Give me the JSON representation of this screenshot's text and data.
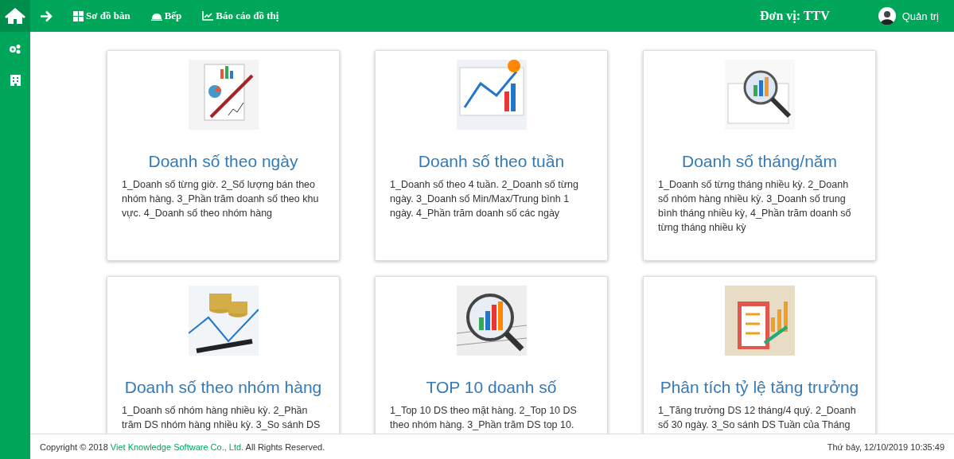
{
  "top_bar": {
    "nav_items": [
      {
        "label": "Sơ đồ bàn",
        "kind": "grid"
      },
      {
        "label": "Bếp",
        "kind": "bell"
      },
      {
        "label": "Báo cáo đồ thị",
        "kind": "chart"
      }
    ],
    "unit": "Đơn vị: TTV",
    "user": "Quản trị"
  },
  "sidebar": {
    "items": [
      {
        "kind": "gears"
      },
      {
        "kind": "building"
      }
    ]
  },
  "cards": [
    {
      "title": "Doanh số theo ngày",
      "description": "1_Doanh số từng giờ. 2_Số lượng bán theo nhóm hàng. 3_Phần trăm doanh số theo khu vực. 4_Doanh số theo nhóm hàng"
    },
    {
      "title": "Doanh số theo tuần",
      "description": "1_Doanh số theo 4 tuần. 2_Doanh số từng ngày. 3_Doanh số Min/Max/Trung bình 1 ngày. 4_Phần trăm doanh số các ngày"
    },
    {
      "title": "Doanh số tháng/năm",
      "description": "1_Doanh số từng tháng nhiều kỳ. 2_Doanh số nhóm hàng nhiều kỳ. 3_Doanh số trung bình tháng nhiều kỳ, 4_Phần trăm doanh số từng tháng nhiều kỳ"
    },
    {
      "title": "Doanh số theo nhóm hàng",
      "description": "1_Doanh số nhóm hàng nhiều kỳ. 2_Phần trăm DS nhóm hàng nhiều kỳ. 3_So sánh DS"
    },
    {
      "title": "TOP 10 doanh số",
      "description": "1_Top 10 DS theo mặt hàng. 2_Top 10 DS theo nhóm hàng. 3_Phần trăm DS top 10."
    },
    {
      "title": "Phân tích tỷ lệ tăng trưởng",
      "description": "1_Tăng trưởng DS 12 tháng/4 quý. 2_Doanh số 30 ngày. 3_So sánh DS Tuần của Tháng"
    }
  ],
  "footer": {
    "copyright_prefix": "Copyright © 2018",
    "company_link": "Viet Knowledge Software Co., Ltd.",
    "copyright_suffix": "All Rights Reserved.",
    "datetime": "Thứ bảy, 12/10/2019 10:35:49"
  }
}
